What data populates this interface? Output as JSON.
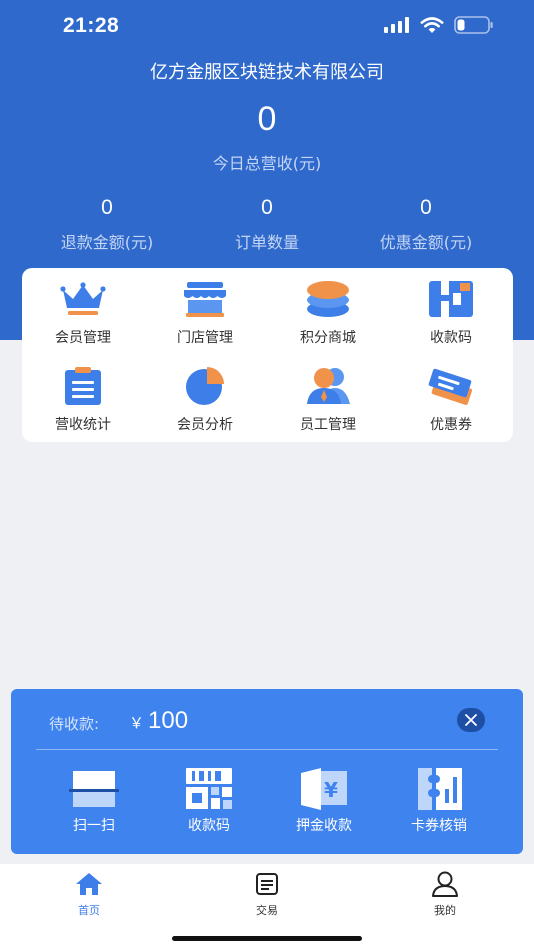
{
  "status_bar": {
    "time": "21:28"
  },
  "header": {
    "company": "亿方金服区块链技术有限公司",
    "total_value": "0",
    "total_label": "今日总营收(元)",
    "stats": [
      {
        "value": "0",
        "label": "退款金额(元)"
      },
      {
        "value": "0",
        "label": "订单数量"
      },
      {
        "value": "0",
        "label": "优惠金额(元)"
      }
    ]
  },
  "menu": {
    "items": [
      {
        "label": "会员管理",
        "icon": "crown-icon"
      },
      {
        "label": "门店管理",
        "icon": "store-icon"
      },
      {
        "label": "积分商城",
        "icon": "coins-stack-icon"
      },
      {
        "label": "收款码",
        "icon": "payment-code-icon"
      },
      {
        "label": "营收统计",
        "icon": "clipboard-icon"
      },
      {
        "label": "会员分析",
        "icon": "pie-chart-icon"
      },
      {
        "label": "员工管理",
        "icon": "staff-icon"
      },
      {
        "label": "优惠券",
        "icon": "coupon-icon"
      }
    ]
  },
  "payment": {
    "pending_label": "待收款:",
    "currency": "￥",
    "amount": "100",
    "actions": [
      {
        "label": "扫一扫",
        "icon": "scan-icon"
      },
      {
        "label": "收款码",
        "icon": "qr-code-icon"
      },
      {
        "label": "押金收款",
        "icon": "deposit-icon"
      },
      {
        "label": "卡券核销",
        "icon": "ticket-icon"
      }
    ]
  },
  "tabbar": {
    "tabs": [
      {
        "label": "首页",
        "icon": "home-icon",
        "active": true
      },
      {
        "label": "交易",
        "icon": "document-icon",
        "active": false
      },
      {
        "label": "我的",
        "icon": "user-icon",
        "active": false
      }
    ]
  },
  "colors": {
    "header_blue": "#2f69cc",
    "panel_blue": "#3f83ee",
    "accent_orange": "#f0924a",
    "icon_blue": "#3d7ee8"
  }
}
